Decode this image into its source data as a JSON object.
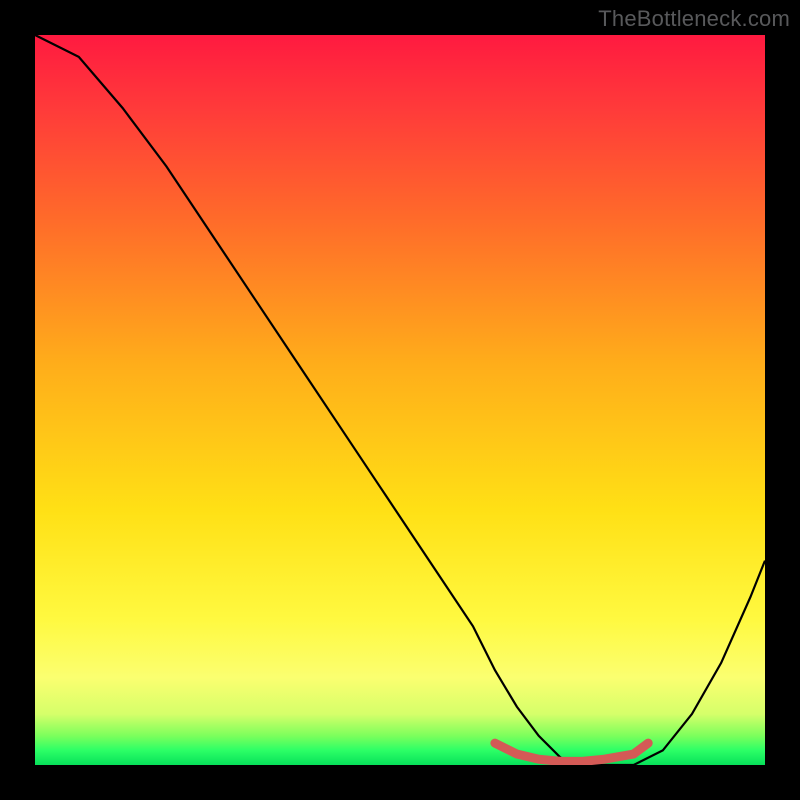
{
  "attribution": "TheBottleneck.com",
  "chart_data": {
    "type": "line",
    "title": "",
    "xlabel": "",
    "ylabel": "",
    "xlim": [
      0,
      100
    ],
    "ylim": [
      0,
      100
    ],
    "series": [
      {
        "name": "curve",
        "x": [
          0,
          6,
          12,
          18,
          24,
          30,
          36,
          42,
          48,
          54,
          60,
          63,
          66,
          69,
          72,
          75,
          78,
          82,
          86,
          90,
          94,
          98,
          100
        ],
        "values": [
          100,
          97,
          90,
          82,
          73,
          64,
          55,
          46,
          37,
          28,
          19,
          13,
          8,
          4,
          1,
          0,
          0,
          0,
          2,
          7,
          14,
          23,
          28
        ]
      },
      {
        "name": "highlight-band",
        "x": [
          63,
          66,
          69,
          72,
          75,
          78,
          82,
          84
        ],
        "values": [
          3,
          1.5,
          0.8,
          0.5,
          0.5,
          0.8,
          1.5,
          3
        ]
      }
    ],
    "colors": {
      "curve": "#000000",
      "highlight": "#d45a56"
    }
  }
}
